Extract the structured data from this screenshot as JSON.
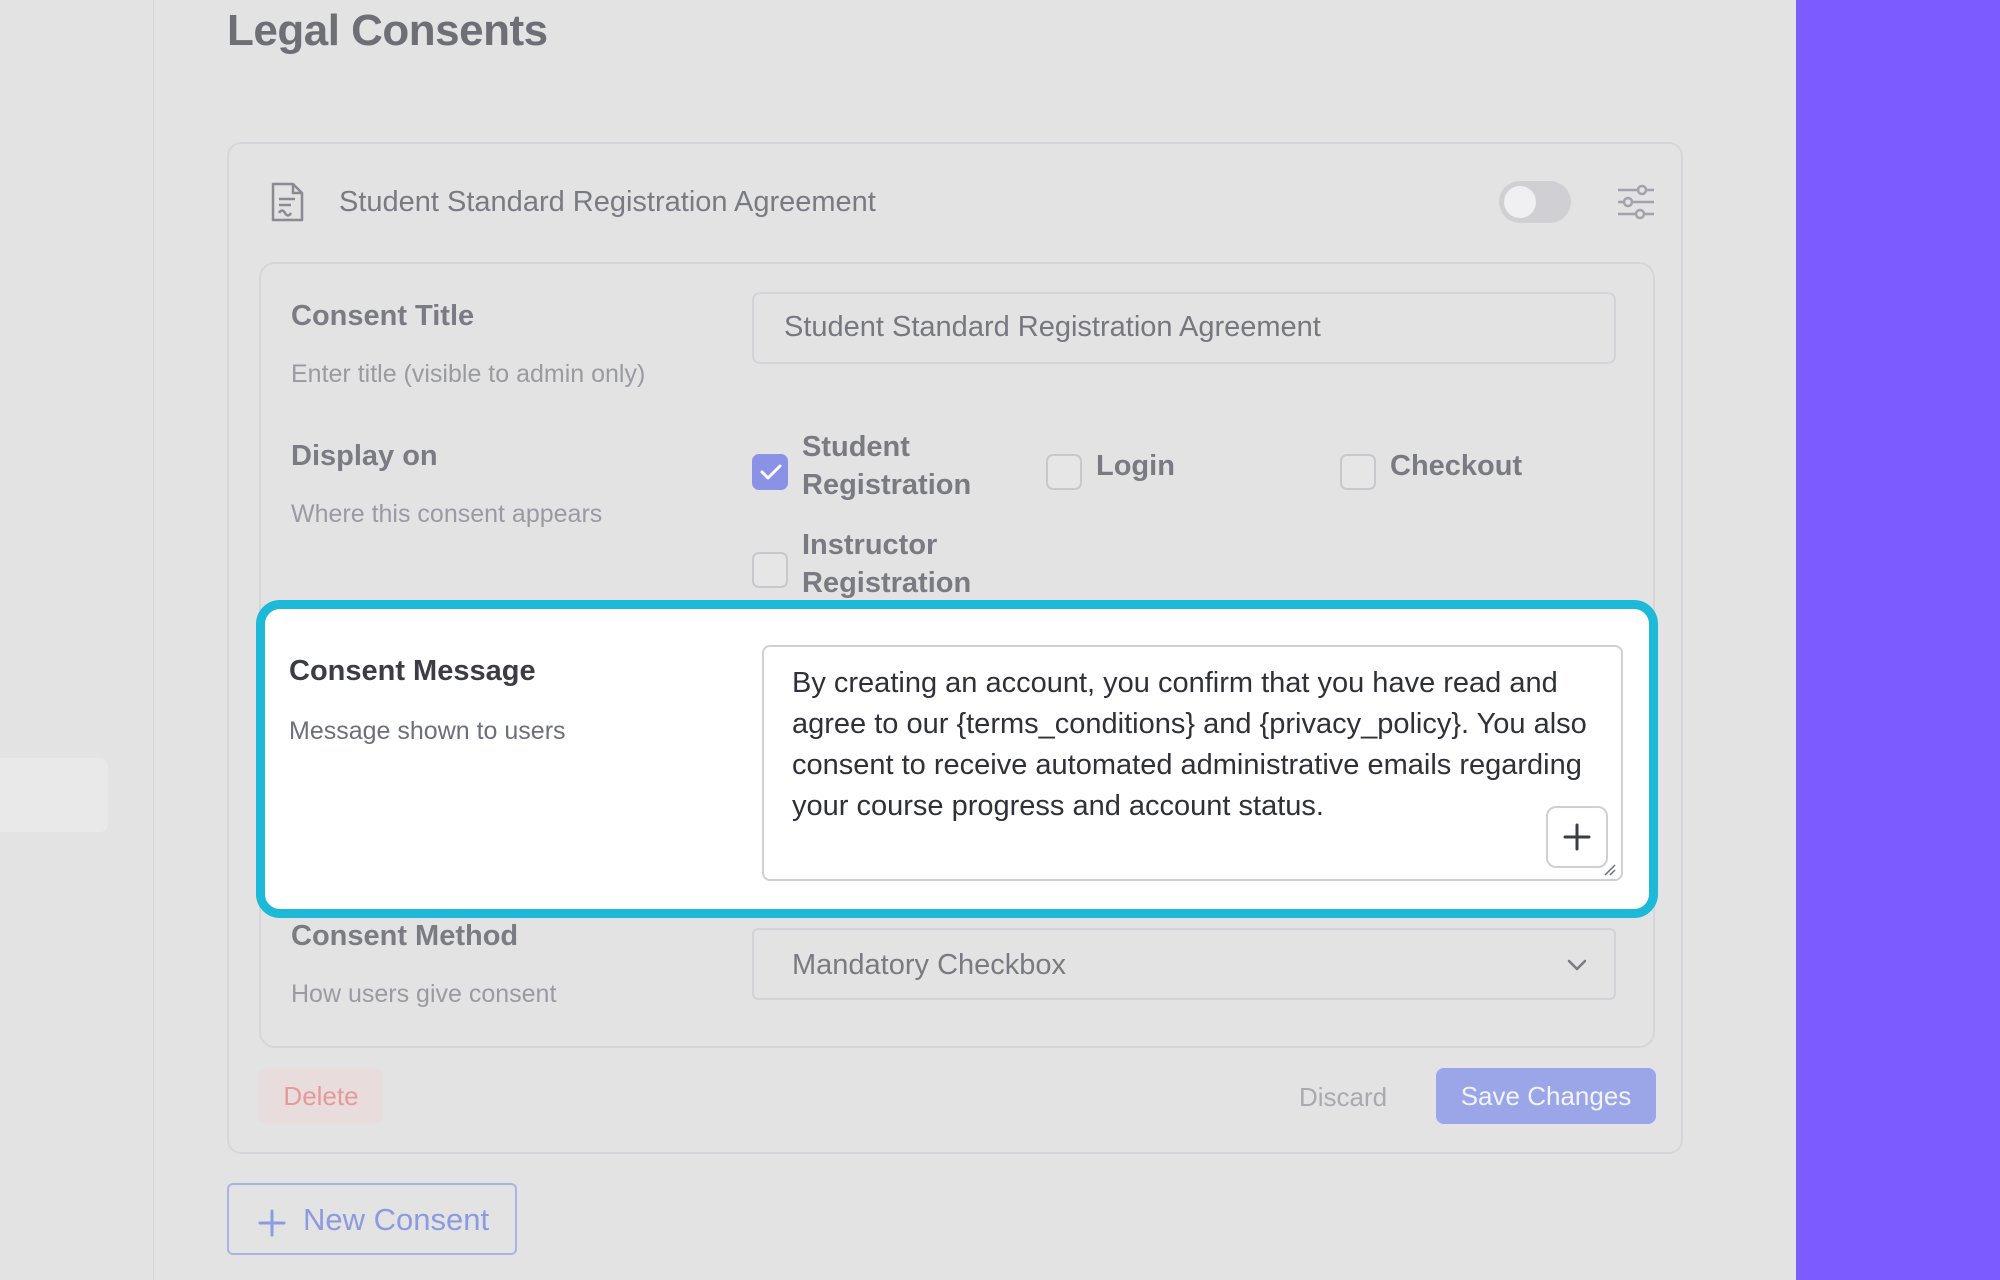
{
  "page": {
    "title": "Legal Consents"
  },
  "consent": {
    "name": "Student Standard Registration Agreement",
    "enabled": false,
    "fields": {
      "title": {
        "label": "Consent Title",
        "hint": "Enter title (visible to admin only)",
        "value": "Student Standard Registration Agreement"
      },
      "display_on": {
        "label": "Display on",
        "hint": "Where this consent appears",
        "options": [
          {
            "line1": "Student",
            "line2": "Registration",
            "checked": true
          },
          {
            "line1": "Login",
            "checked": false
          },
          {
            "line1": "Checkout",
            "checked": false
          },
          {
            "line1": "Instructor",
            "line2": "Registration",
            "checked": false
          }
        ]
      },
      "message": {
        "label": "Consent Message",
        "hint": "Message shown to users",
        "value": "By creating an account, you confirm that you have read and agree to our {terms_conditions} and {privacy_policy}. You also consent to receive automated administrative emails regarding your course progress and account status."
      },
      "method": {
        "label": "Consent Method",
        "hint": "How users give consent",
        "value": "Mandatory Checkbox"
      }
    },
    "actions": {
      "delete": "Delete",
      "discard": "Discard",
      "save": "Save Changes"
    }
  },
  "new_consent": "New Consent",
  "colors": {
    "accent_band": "#7c5cff",
    "highlight": "#1cb9d8",
    "checkbox": "#8a92e6",
    "delete": "#e59a9a"
  },
  "icons": [
    "document-icon",
    "sliders-icon",
    "check-icon",
    "plus-icon",
    "chevron-down-icon",
    "resize-handle-icon"
  ]
}
